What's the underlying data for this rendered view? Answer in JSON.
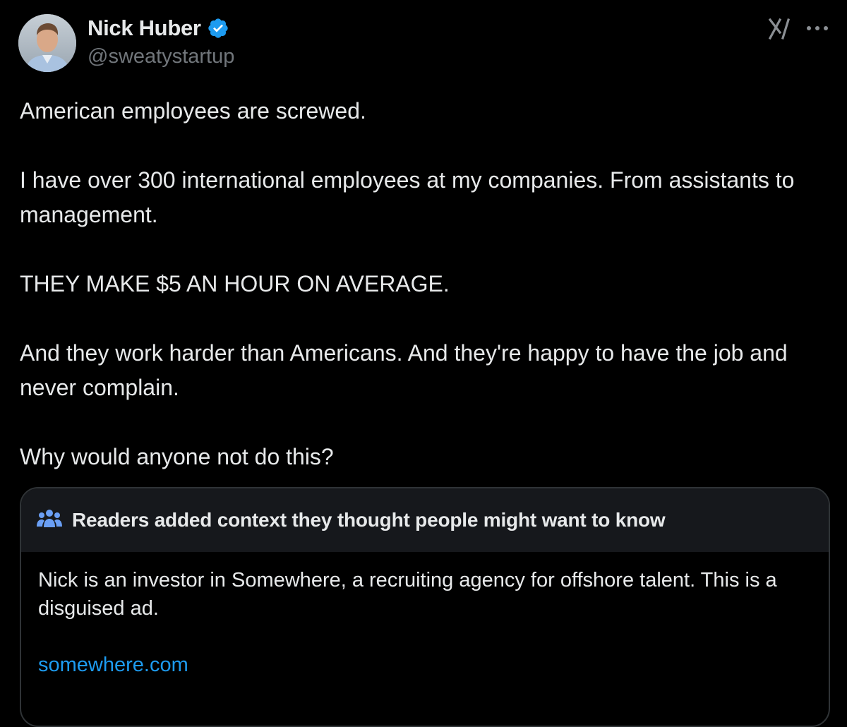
{
  "author": {
    "display_name": "Nick Huber",
    "handle": "@sweatystartup",
    "verified": true
  },
  "icons": {
    "verified": "verified-badge-icon",
    "grok": "grok-icon",
    "more": "more-options-icon",
    "community": "community-people-icon"
  },
  "tweet": {
    "paragraphs": [
      "American employees are screwed.",
      "I have over 300 international employees at my companies. From assistants to management.",
      "THEY MAKE $5 AN HOUR ON AVERAGE.",
      "And they work harder than Americans. And they're happy to have the job and never complain.",
      "Why would anyone not do this?"
    ]
  },
  "community_note": {
    "title": "Readers added context they thought people might want to know",
    "body": "Nick is an investor in Somewhere, a recruiting agency for offshore talent. This is a disguised ad.",
    "link_text": "somewhere.com"
  },
  "colors": {
    "background": "#000000",
    "text": "#e7e9ea",
    "secondary": "#71767b",
    "accent": "#1d9bf0",
    "border": "#2f3336",
    "note_header_bg": "#16181c"
  }
}
